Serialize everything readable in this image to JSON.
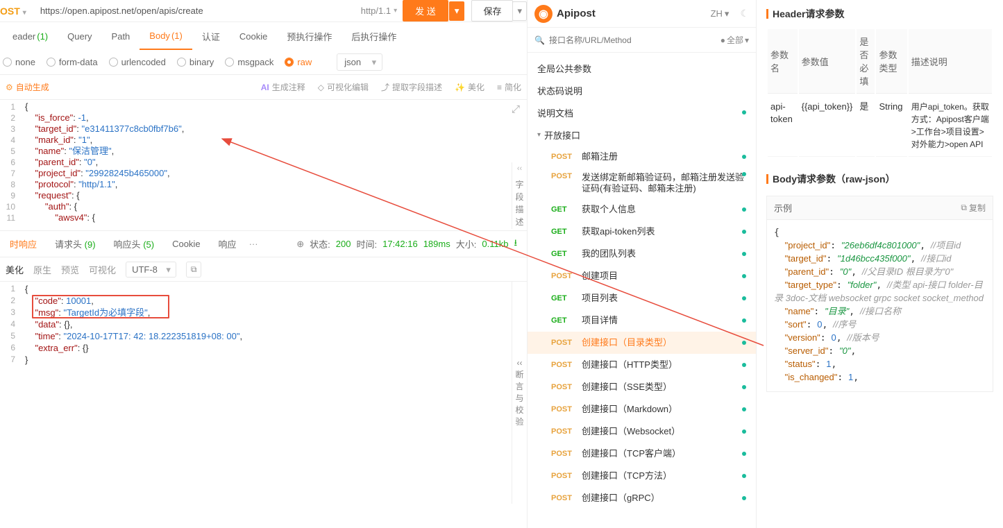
{
  "urlbar": {
    "method": "OST",
    "url": "https://open.apipost.net/open/apis/create",
    "http": "http/1.1",
    "send": "发 送",
    "save": "保存"
  },
  "tabs": {
    "header": "eader",
    "header_cnt": "(1)",
    "query": "Query",
    "path": "Path",
    "body": "Body",
    "body_cnt": "(1)",
    "auth": "认证",
    "cookie": "Cookie",
    "pre": "预执行操作",
    "post": "后执行操作"
  },
  "radios": {
    "none": "none",
    "formdata": "form-data",
    "urlencoded": "urlencoded",
    "binary": "binary",
    "msgpack": "msgpack",
    "raw": "raw",
    "json": "json"
  },
  "tbar": {
    "gen": "自动生成",
    "ai": "AI",
    "comment": "生成注释",
    "visual": "可视化编辑",
    "extract": "提取字段描述",
    "beauty": "美化",
    "simplify": "简化"
  },
  "vbar": {
    "t1": "字",
    "t2": "段",
    "t3": "描",
    "t4": "述"
  },
  "editor": {
    "lines": [
      "{",
      "    \"is_force\": -1,",
      "    \"target_id\": \"e31411377c8cb0fbf7b6\",",
      "    \"mark_id\": \"1\",",
      "    \"name\": \"保洁管理\",",
      "    \"parent_id\": \"0\",",
      "    \"project_id\": \"29928245b465000\",",
      "    \"protocol\": \"http/1.1\",",
      "    \"request\": {",
      "        \"auth\": {",
      "            \"awsv4\": {"
    ]
  },
  "resp_tabs": {
    "realtime": "时响应",
    "reqh": "请求头",
    "reqh_cnt": "(9)",
    "resph": "响应头",
    "resph_cnt": "(5)",
    "cookie": "Cookie",
    "resp": "响应",
    "status": "状态:",
    "code": "200",
    "time_lbl": "时间:",
    "time": "17:42:16",
    "duration": "189ms",
    "size_lbl": "大小:",
    "size": "0.11kb"
  },
  "resp_toolbar": {
    "beauty": "美化",
    "raw": "原生",
    "preview": "预览",
    "visual": "可视化",
    "encoding": "UTF-8"
  },
  "resp_vbar": {
    "t1": "断",
    "t2": "言",
    "t3": "与",
    "t4": "校",
    "t5": "验"
  },
  "resp_body": {
    "lines": [
      "{",
      "    \"code\": 10001,",
      "    \"msg\": \"TargetId为必填字段\",",
      "    \"data\": {},",
      "    \"time\": \"2024-10-17T17:42:18.222351819+08:00\",",
      "    \"extra_err\": {}",
      "}"
    ]
  },
  "mp": {
    "brand": "Apipost",
    "lang": "ZH",
    "search_ph": "接口名称/URL/Method",
    "filter": "全部",
    "sections": {
      "global": "全局公共参数",
      "status": "状态码说明",
      "doc": "说明文档",
      "open": "开放接口"
    },
    "apis": [
      {
        "m": "POST",
        "l": "邮箱注册"
      },
      {
        "m": "POST",
        "l": "发送绑定新邮箱验证码，邮箱注册发送验证码(有验证码、邮箱未注册)"
      },
      {
        "m": "GET",
        "l": "获取个人信息"
      },
      {
        "m": "GET",
        "l": "获取api-token列表"
      },
      {
        "m": "GET",
        "l": "我的团队列表"
      },
      {
        "m": "POST",
        "l": "创建项目"
      },
      {
        "m": "GET",
        "l": "项目列表"
      },
      {
        "m": "GET",
        "l": "项目详情"
      },
      {
        "m": "POST",
        "l": "创建接口（目录类型）"
      },
      {
        "m": "POST",
        "l": "创建接口（HTTP类型）"
      },
      {
        "m": "POST",
        "l": "创建接口（SSE类型）"
      },
      {
        "m": "POST",
        "l": "创建接口（Markdown）"
      },
      {
        "m": "POST",
        "l": "创建接口（Websocket）"
      },
      {
        "m": "POST",
        "l": "创建接口（TCP客户端）"
      },
      {
        "m": "POST",
        "l": "创建接口（TCP方法）"
      },
      {
        "m": "POST",
        "l": "创建接口（gRPC）"
      }
    ]
  },
  "rp": {
    "header_title": "Header请求参数",
    "th": {
      "name": "参数名",
      "value": "参数值",
      "req": "是否必填",
      "type": "参数类型",
      "desc": "描述说明"
    },
    "row": {
      "name": "api-token",
      "value": "{{api_token}}",
      "req": "是",
      "type": "String",
      "desc": "用户api_token。获取方式：Apipost客户端>工作台>项目设置>对外能力>open API"
    },
    "body_title": "Body请求参数（raw-json）",
    "example": "示例",
    "copy": "复制"
  },
  "chart_data": {
    "type": "table",
    "title": "Request JSON body example",
    "fields": [
      {
        "key": "project_id",
        "value": "26eb6df4c801000",
        "comment": "项目id"
      },
      {
        "key": "target_id",
        "value": "1d46bcc435f000",
        "comment": "接口id"
      },
      {
        "key": "parent_id",
        "value": "0",
        "comment": "父目录ID 根目录为\"0\""
      },
      {
        "key": "target_type",
        "value": "folder",
        "comment": "类型 api-接口 folder-目录 3doc-文档 websocket grpc socket socket_method"
      },
      {
        "key": "name",
        "value": "目录",
        "comment": "接口名称"
      },
      {
        "key": "sort",
        "value": 0,
        "comment": "序号"
      },
      {
        "key": "version",
        "value": 0,
        "comment": "版本号"
      },
      {
        "key": "server_id",
        "value": "0",
        "comment": ""
      },
      {
        "key": "status",
        "value": 1,
        "comment": ""
      },
      {
        "key": "is_changed",
        "value": 1,
        "comment": ""
      }
    ]
  }
}
